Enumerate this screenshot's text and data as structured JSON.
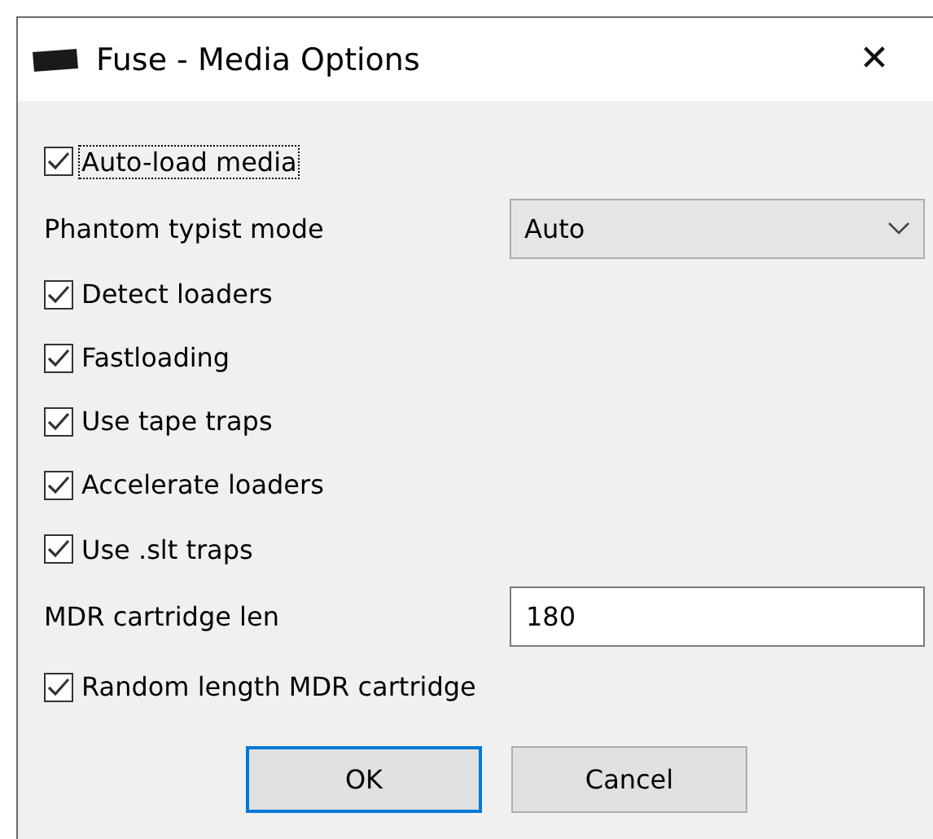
{
  "window": {
    "title": "Fuse - Media Options",
    "close": "✕"
  },
  "options": [
    {
      "kind": "checkbox",
      "label": "Auto-load media",
      "checked": true,
      "focused": true
    },
    {
      "kind": "select",
      "label": "Phantom typist mode",
      "value": "Auto"
    },
    {
      "kind": "checkbox",
      "label": "Detect loaders",
      "checked": true,
      "focused": false
    },
    {
      "kind": "checkbox",
      "label": "Fastloading",
      "checked": true,
      "focused": false
    },
    {
      "kind": "checkbox",
      "label": "Use tape traps",
      "checked": true,
      "focused": false
    },
    {
      "kind": "checkbox",
      "label": "Accelerate loaders",
      "checked": true,
      "focused": false
    },
    {
      "kind": "checkbox",
      "label": "Use .slt traps",
      "checked": true,
      "focused": false
    },
    {
      "kind": "text",
      "label": "MDR cartridge len",
      "value": "180"
    },
    {
      "kind": "checkbox",
      "label": "Random length MDR cartridge",
      "checked": true,
      "focused": false
    }
  ],
  "buttons": [
    {
      "label": "OK",
      "default": true
    },
    {
      "label": "Cancel",
      "default": false
    }
  ]
}
